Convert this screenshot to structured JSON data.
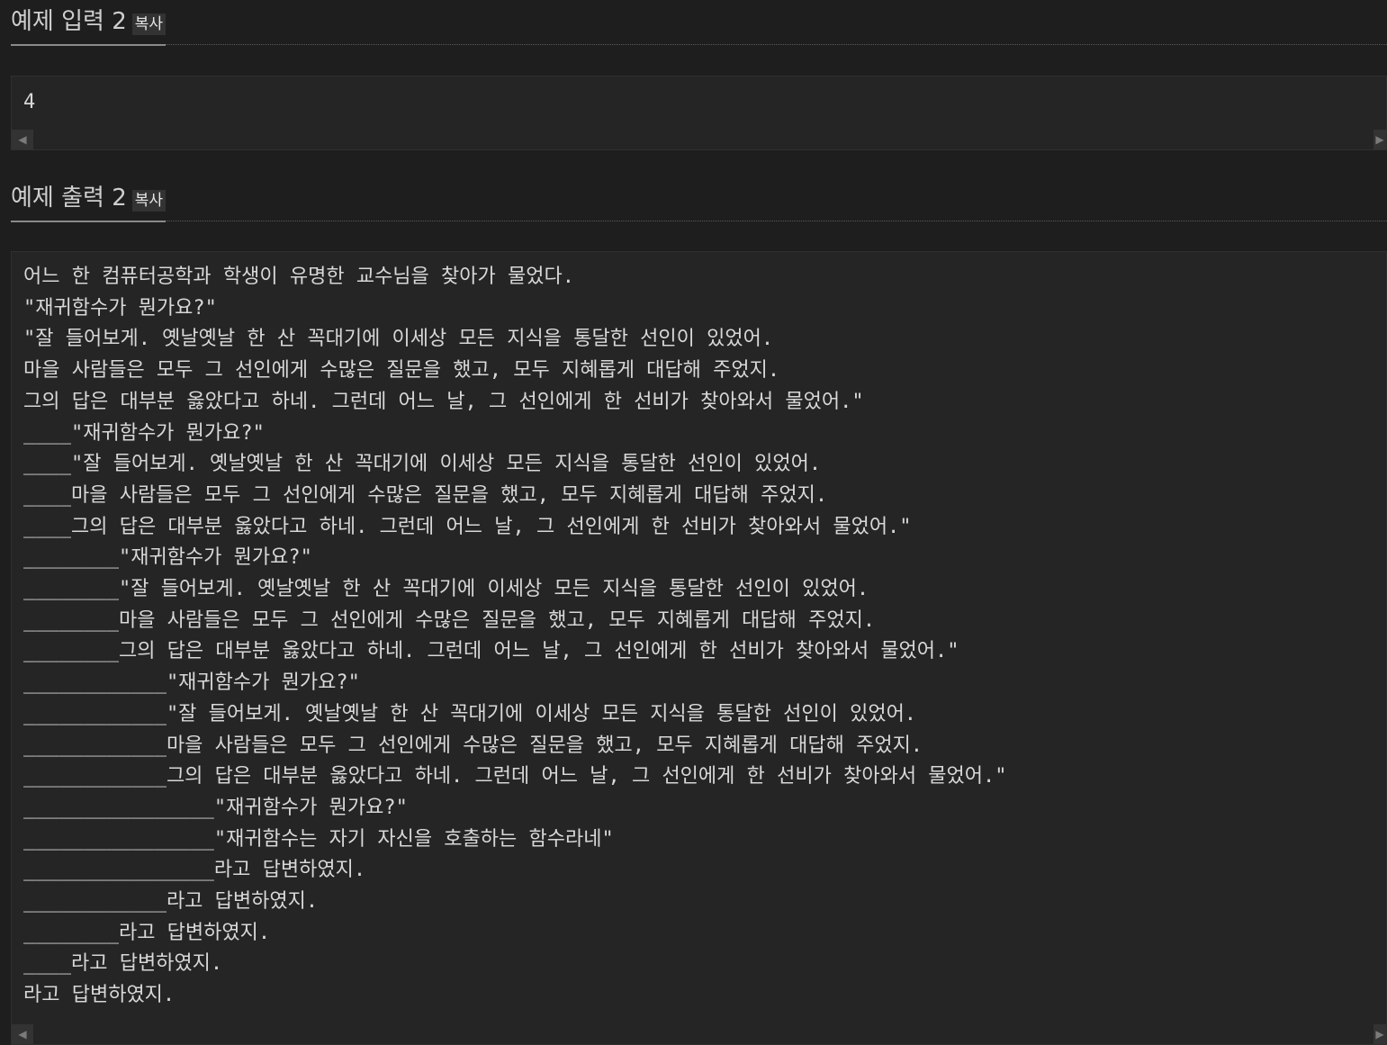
{
  "input_section": {
    "title": "예제 입력 2",
    "copy_label": "복사",
    "content": "4"
  },
  "output_section": {
    "title": "예제 출력 2",
    "copy_label": "복사",
    "content": "어느 한 컴퓨터공학과 학생이 유명한 교수님을 찾아가 물었다.\n\"재귀함수가 뭔가요?\"\n\"잘 들어보게. 옛날옛날 한 산 꼭대기에 이세상 모든 지식을 통달한 선인이 있었어.\n마을 사람들은 모두 그 선인에게 수많은 질문을 했고, 모두 지혜롭게 대답해 주었지.\n그의 답은 대부분 옳았다고 하네. 그런데 어느 날, 그 선인에게 한 선비가 찾아와서 물었어.\"\n____\"재귀함수가 뭔가요?\"\n____\"잘 들어보게. 옛날옛날 한 산 꼭대기에 이세상 모든 지식을 통달한 선인이 있었어.\n____마을 사람들은 모두 그 선인에게 수많은 질문을 했고, 모두 지혜롭게 대답해 주었지.\n____그의 답은 대부분 옳았다고 하네. 그런데 어느 날, 그 선인에게 한 선비가 찾아와서 물었어.\"\n________\"재귀함수가 뭔가요?\"\n________\"잘 들어보게. 옛날옛날 한 산 꼭대기에 이세상 모든 지식을 통달한 선인이 있었어.\n________마을 사람들은 모두 그 선인에게 수많은 질문을 했고, 모두 지혜롭게 대답해 주었지.\n________그의 답은 대부분 옳았다고 하네. 그런데 어느 날, 그 선인에게 한 선비가 찾아와서 물었어.\"\n____________\"재귀함수가 뭔가요?\"\n____________\"잘 들어보게. 옛날옛날 한 산 꼭대기에 이세상 모든 지식을 통달한 선인이 있었어.\n____________마을 사람들은 모두 그 선인에게 수많은 질문을 했고, 모두 지혜롭게 대답해 주었지.\n____________그의 답은 대부분 옳았다고 하네. 그런데 어느 날, 그 선인에게 한 선비가 찾아와서 물었어.\"\n________________\"재귀함수가 뭔가요?\"\n________________\"재귀함수는 자기 자신을 호출하는 함수라네\"\n________________라고 답변하였지.\n____________라고 답변하였지.\n________라고 답변하였지.\n____라고 답변하였지.\n라고 답변하였지."
  },
  "scrollbar": {
    "left_arrow_icon": "triangle-left-icon",
    "right_arrow_icon": "triangle-right-icon"
  }
}
